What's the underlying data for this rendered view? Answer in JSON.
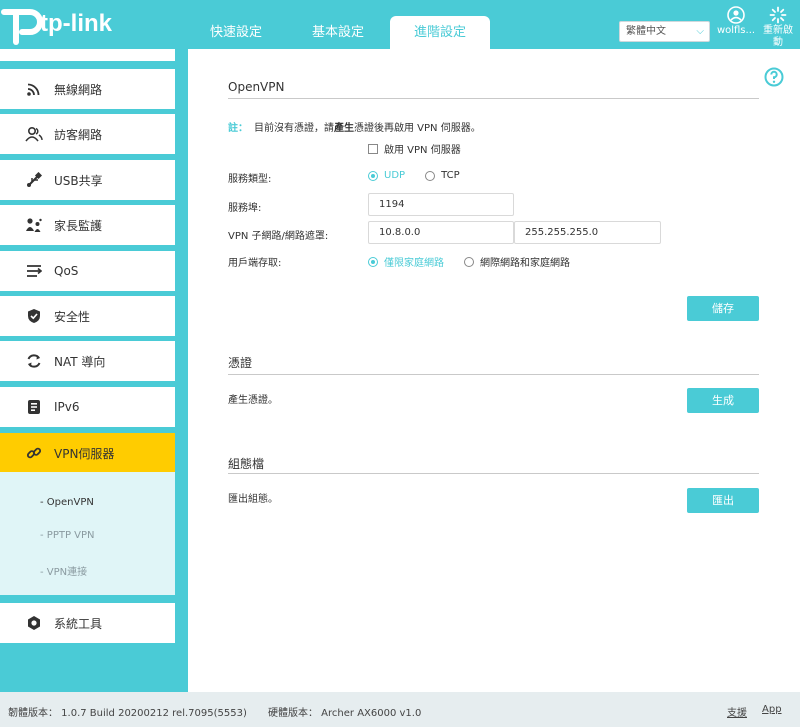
{
  "brand": {
    "name": "tp-link",
    "accent": "#4acbd6",
    "highlight": "#ffcc00"
  },
  "nav": {
    "tabs": [
      {
        "label": "快速設定"
      },
      {
        "label": "基本設定"
      },
      {
        "label": "進階設定",
        "active": true
      }
    ]
  },
  "header": {
    "language": "繁體中文",
    "user_label": "wolfls...",
    "reboot_label_line1": "重新啟",
    "reboot_label_line2": "動"
  },
  "sidebar": {
    "items": [
      {
        "label": "無線網路",
        "icon": "wifi-icon"
      },
      {
        "label": "訪客網路",
        "icon": "guest-icon"
      },
      {
        "label": "USB共享",
        "icon": "usb-icon"
      },
      {
        "label": "家長監護",
        "icon": "parental-icon"
      },
      {
        "label": "QoS",
        "icon": "qos-icon"
      },
      {
        "label": "安全性",
        "icon": "shield-icon"
      },
      {
        "label": "NAT 導向",
        "icon": "nat-icon"
      },
      {
        "label": "IPv6",
        "icon": "ipv6-icon"
      },
      {
        "label": "VPN伺服器",
        "icon": "link-icon",
        "active": true
      },
      {
        "label": "系統工具",
        "icon": "gear-icon"
      }
    ],
    "submenu": [
      {
        "label": "- OpenVPN",
        "active": true
      },
      {
        "label": "- PPTP VPN"
      },
      {
        "label": "- VPN連接"
      }
    ]
  },
  "openvpn": {
    "title": "OpenVPN",
    "note_label": "註：",
    "note_text_1": "目前沒有憑證，請",
    "note_bold": "產生",
    "note_text_2": "憑證後再啟用 VPN 伺服器。",
    "enable_label": "啟用 VPN 伺服器",
    "service_type_label": "服務類型:",
    "service_type_options": [
      "UDP",
      "TCP"
    ],
    "service_type_selected": "UDP",
    "port_label": "服務埠:",
    "port_value": "1194",
    "subnet_label": "VPN 子網路/網路遮罩:",
    "subnet_value": "10.8.0.0",
    "netmask_value": "255.255.255.0",
    "client_access_label": "用戶端存取:",
    "client_access_options": [
      "僅限家庭網路",
      "網際網路和家庭網路"
    ],
    "client_access_selected": "僅限家庭網路",
    "save_label": "儲存"
  },
  "certificate": {
    "title": "憑證",
    "text": "產生憑證。",
    "button_label": "生成"
  },
  "config": {
    "title": "組態檔",
    "text": "匯出組態。",
    "button_label": "匯出"
  },
  "footer": {
    "firmware": "韌體版本： 1.0.7 Build 20200212 rel.7095(5553)",
    "hardware": "硬體版本： Archer AX6000 v1.0",
    "support": "支援",
    "app": "App"
  }
}
